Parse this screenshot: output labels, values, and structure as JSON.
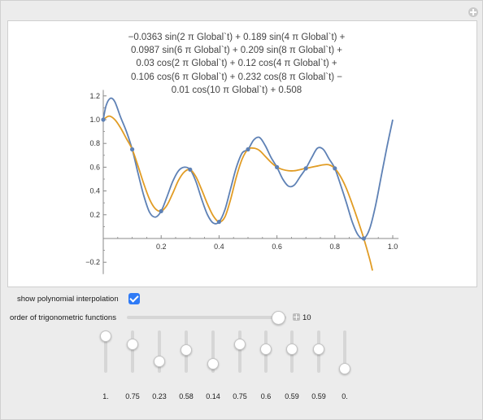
{
  "formula_lines": [
    "−0.0363 sin(2 π Global`t) + 0.189 sin(4 π Global`t) +",
    "0.0987 sin(6 π Global`t) + 0.209 sin(8 π Global`t) +",
    "0.03 cos(2 π Global`t) + 0.12 cos(4 π Global`t) +",
    "0.106 cos(6 π Global`t) + 0.232 cos(8 π Global`t) −",
    "0.01 cos(10 π Global`t) + 0.508"
  ],
  "controls": {
    "show_poly_label": "show polynomial interpolation",
    "show_poly_checked": true,
    "order_label": "order of trigonometric functions",
    "order_value": "10",
    "order_fraction": 0.95
  },
  "sliders": [
    {
      "label": "1.",
      "value": 1.0
    },
    {
      "label": "0.75",
      "value": 0.75
    },
    {
      "label": "0.23",
      "value": 0.23
    },
    {
      "label": "0.58",
      "value": 0.58
    },
    {
      "label": "0.14",
      "value": 0.14
    },
    {
      "label": "0.75",
      "value": 0.75
    },
    {
      "label": "0.6",
      "value": 0.6
    },
    {
      "label": "0.59",
      "value": 0.59
    },
    {
      "label": "0.59",
      "value": 0.59
    },
    {
      "label": "0.",
      "value": 0.0
    }
  ],
  "colors": {
    "trig": "#5e81b5",
    "poly": "#e19c24",
    "axis": "#888888"
  },
  "chart_data": {
    "type": "line",
    "xlim": [
      0,
      1.0
    ],
    "ylim": [
      -0.3,
      1.25
    ],
    "x_ticks": [
      0.2,
      0.4,
      0.6,
      0.8,
      1.0
    ],
    "x_tick_labels": [
      "0.2",
      "0.4",
      "0.6",
      "0.8",
      "1.0"
    ],
    "y_ticks": [
      -0.2,
      0.2,
      0.4,
      0.6,
      0.8,
      1.0,
      1.2
    ],
    "y_tick_labels": [
      "−0.2",
      "0.2",
      "0.4",
      "0.6",
      "0.8",
      "1.0",
      "1.2"
    ],
    "points": {
      "x": [
        0.0,
        0.1,
        0.2,
        0.3,
        0.4,
        0.5,
        0.6,
        0.7,
        0.8,
        0.9
      ],
      "y": [
        1.0,
        0.75,
        0.23,
        0.58,
        0.14,
        0.75,
        0.6,
        0.59,
        0.59,
        0.0
      ]
    },
    "series": [
      {
        "x": [
          0.0,
          0.01,
          0.025,
          0.04,
          0.06,
          0.08,
          0.1,
          0.12,
          0.14,
          0.16,
          0.18,
          0.2,
          0.22,
          0.24,
          0.26,
          0.28,
          0.3,
          0.32,
          0.34,
          0.36,
          0.38,
          0.4,
          0.42,
          0.44,
          0.46,
          0.48,
          0.5,
          0.52,
          0.54,
          0.56,
          0.58,
          0.6,
          0.62,
          0.64,
          0.66,
          0.68,
          0.7,
          0.72,
          0.74,
          0.76,
          0.78,
          0.8,
          0.82,
          0.84,
          0.86,
          0.88,
          0.9,
          0.92,
          0.94,
          0.96,
          0.98,
          1.0
        ],
        "y": [
          1.0,
          1.12,
          1.18,
          1.15,
          1.02,
          0.9,
          0.75,
          0.55,
          0.36,
          0.22,
          0.18,
          0.23,
          0.35,
          0.48,
          0.57,
          0.6,
          0.58,
          0.48,
          0.33,
          0.2,
          0.13,
          0.14,
          0.24,
          0.42,
          0.6,
          0.72,
          0.75,
          0.83,
          0.85,
          0.78,
          0.68,
          0.6,
          0.5,
          0.44,
          0.45,
          0.52,
          0.59,
          0.68,
          0.76,
          0.75,
          0.67,
          0.59,
          0.45,
          0.3,
          0.14,
          0.03,
          0.0,
          0.08,
          0.27,
          0.52,
          0.77,
          1.0
        ]
      },
      {
        "x": [
          0.0,
          0.02,
          0.04,
          0.06,
          0.08,
          0.1,
          0.12,
          0.14,
          0.16,
          0.18,
          0.2,
          0.22,
          0.24,
          0.26,
          0.28,
          0.3,
          0.32,
          0.34,
          0.36,
          0.38,
          0.4,
          0.42,
          0.44,
          0.46,
          0.48,
          0.5,
          0.52,
          0.54,
          0.56,
          0.58,
          0.6,
          0.62,
          0.64,
          0.66,
          0.68,
          0.7,
          0.72,
          0.74,
          0.76,
          0.78,
          0.8,
          0.82,
          0.84,
          0.86,
          0.88,
          0.9,
          0.92,
          0.93
        ],
        "y": [
          1.0,
          1.03,
          1.0,
          0.93,
          0.84,
          0.75,
          0.61,
          0.46,
          0.33,
          0.25,
          0.23,
          0.28,
          0.38,
          0.49,
          0.56,
          0.58,
          0.52,
          0.41,
          0.29,
          0.19,
          0.14,
          0.18,
          0.33,
          0.52,
          0.67,
          0.75,
          0.76,
          0.74,
          0.69,
          0.64,
          0.6,
          0.58,
          0.57,
          0.57,
          0.58,
          0.59,
          0.6,
          0.61,
          0.62,
          0.62,
          0.59,
          0.52,
          0.42,
          0.29,
          0.15,
          0.0,
          -0.17,
          -0.27
        ]
      }
    ]
  }
}
